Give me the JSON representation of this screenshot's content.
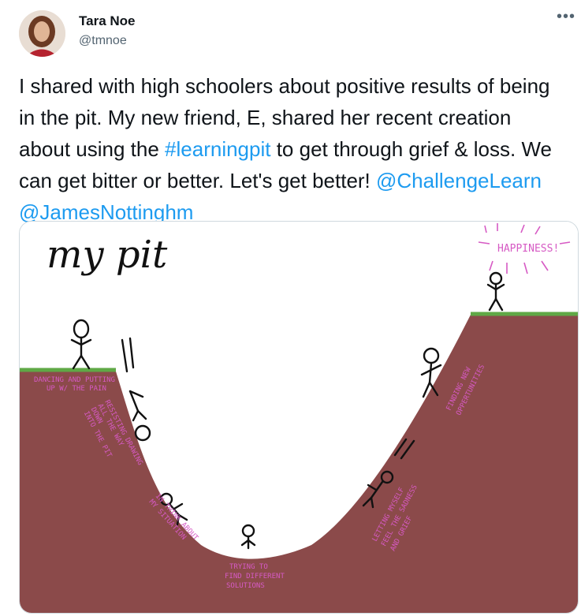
{
  "tweet": {
    "author_name": "Tara Noe",
    "author_handle": "@tmnoe",
    "more_icon": "ellipsis-icon",
    "text_parts": {
      "p1": "I shared with high schoolers about positive results of being in the pit. My new friend, E, shared her recent creation about using the ",
      "hashtag": "#learningpit",
      "p2": " to get through grief & loss. We can get bitter or better. Let's get better! ",
      "mention1": "@ChallengeLearn",
      "space": " ",
      "mention2": "@JamesNottinghm"
    }
  },
  "drawing": {
    "title": "my pit",
    "labels": {
      "happiness": "HAPPINESS!",
      "dancing": [
        "DANCING AND PUTTING",
        "UP W/ THE PAIN"
      ],
      "resisting": [
        "RESISTING DRAWING",
        "ALL THE WAY",
        "DOWN",
        "INTO THE PIT"
      ],
      "thinking": [
        "IN THINK ABOUT",
        "MY SITUATION"
      ],
      "trying": [
        "TRYING TO",
        "FIND DIFFERENT",
        "SOLUTIONS"
      ],
      "letting": [
        "LETTING MYSELF",
        "FEEL THE SADNESS",
        "AND GRIEF"
      ],
      "finding": [
        "FINDING NEW",
        "OPPERTUNITIES"
      ]
    },
    "colors": {
      "dirt": "#8b4a4a",
      "grass": "#5fa846",
      "ink_pink": "#d65ac4",
      "link_blue": "#1d9bf0"
    }
  }
}
